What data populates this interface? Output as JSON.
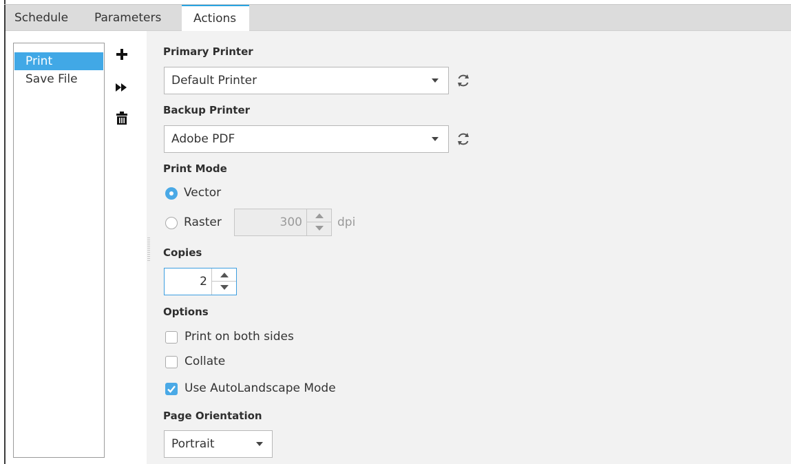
{
  "tabs": [
    {
      "label": "Schedule",
      "active": false
    },
    {
      "label": "Parameters",
      "active": false
    },
    {
      "label": "Actions",
      "active": true
    }
  ],
  "actions_list": {
    "items": [
      {
        "label": "Print",
        "selected": true
      },
      {
        "label": "Save File",
        "selected": false
      }
    ]
  },
  "toolbar": {
    "add_icon": "plus-icon",
    "run_icon": "fast-forward-icon",
    "delete_icon": "trash-icon"
  },
  "form": {
    "primary_printer": {
      "label": "Primary Printer",
      "value": "Default Printer"
    },
    "backup_printer": {
      "label": "Backup Printer",
      "value": "Adobe PDF"
    },
    "print_mode": {
      "label": "Print Mode",
      "vector_label": "Vector",
      "raster_label": "Raster",
      "selected": "Vector",
      "raster_dpi": "300",
      "dpi_unit": "dpi"
    },
    "copies": {
      "label": "Copies",
      "value": "2"
    },
    "options": {
      "label": "Options",
      "both_sides": {
        "label": "Print on both sides",
        "checked": false
      },
      "collate": {
        "label": "Collate",
        "checked": false
      },
      "autolandscape": {
        "label": "Use AutoLandscape Mode",
        "checked": true
      }
    },
    "page_orientation": {
      "label": "Page Orientation",
      "value": "Portrait"
    }
  },
  "colors": {
    "accent": "#41a8e6",
    "tab_active_border": "#29a3e0",
    "panel_bg": "#f2f2f2",
    "tabbar_bg": "#dcdcdc"
  }
}
